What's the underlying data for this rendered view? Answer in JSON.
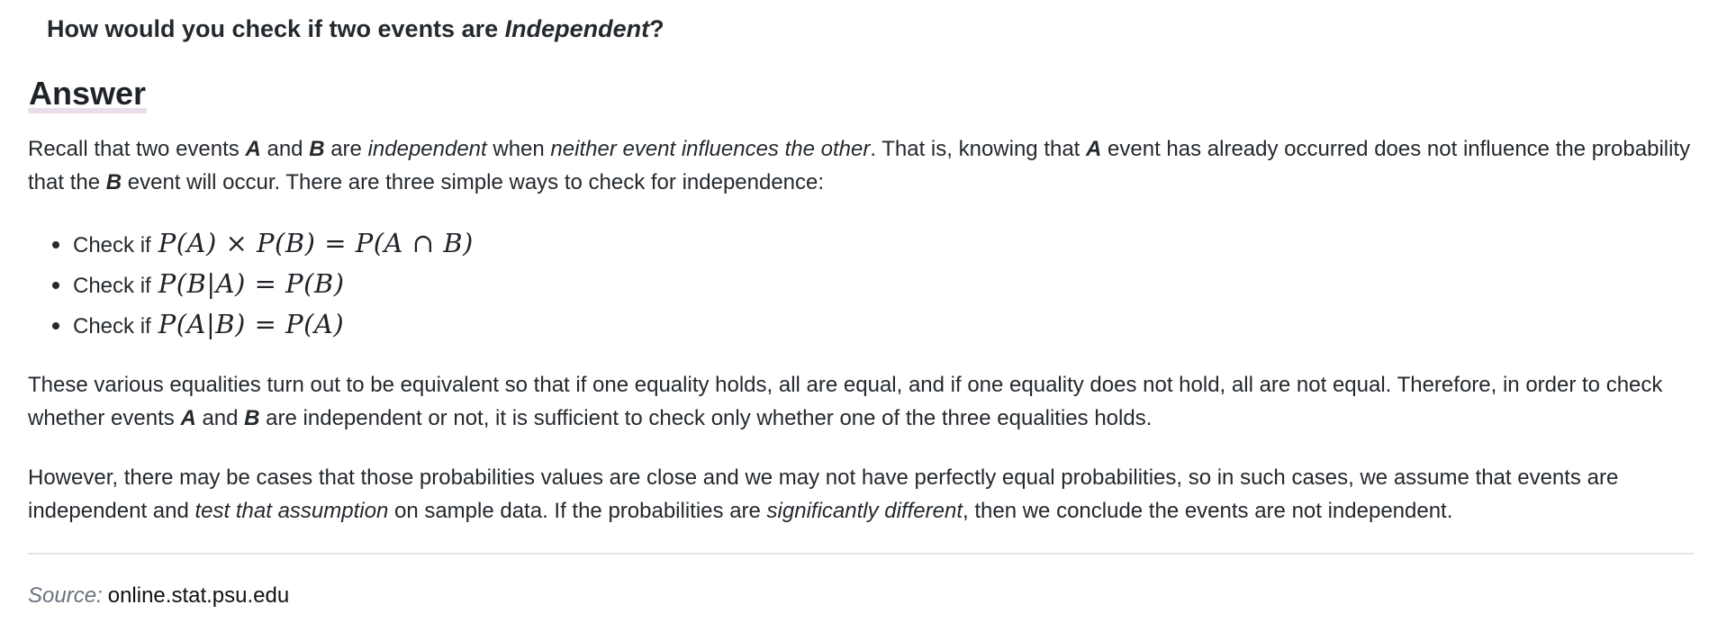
{
  "question": {
    "prefix": "How would you check if two events are ",
    "emph": "Independent",
    "suffix": "?"
  },
  "answer_heading": "Answer",
  "paragraph1": {
    "t1": "Recall that two events ",
    "a": "A",
    "t2": " and ",
    "b": "B",
    "t3": " are ",
    "i1": "independent",
    "t4": " when ",
    "i2": "neither event influences the other",
    "t5": ". That is, knowing that ",
    "a2": "A",
    "t6": " event has already occurred does not influence the probability that the ",
    "b2": "B",
    "t7": " event will occur. There are three simple ways to check for independence:"
  },
  "checks": [
    {
      "label": "Check if",
      "formula": "P(A) × P(B) = P(A ∩ B)"
    },
    {
      "label": "Check if",
      "formula": "P(B|A) = P(B)"
    },
    {
      "label": "Check if",
      "formula": "P(A|B) = P(A)"
    }
  ],
  "paragraph2": {
    "t1": "These various equalities turn out to be equivalent so that if one equality holds, all are equal, and if one equality does not hold, all are not equal. Therefore, in order to check whether events ",
    "a": "A",
    "t2": " and ",
    "b": "B",
    "t3": " are independent or not, it is sufficient to check only whether one of the three equalities holds."
  },
  "paragraph3": {
    "t1": "However, there may be cases that those probabilities values are close and we may not have perfectly equal probabilities, so in such cases, we assume that events are independent and ",
    "i1": "test that assumption",
    "t2": " on sample data. If the probabilities are ",
    "i2": "significantly different",
    "t3": ", then we conclude the events are not independent."
  },
  "source": {
    "label": "Source:",
    "link": "online.stat.psu.edu"
  }
}
